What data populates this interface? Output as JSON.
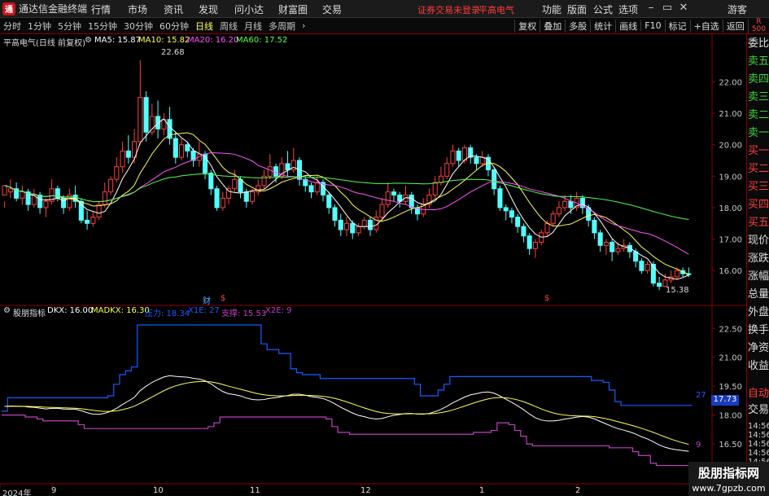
{
  "app": {
    "logo": "通",
    "title": "通达信金融终端",
    "menus": [
      "行情",
      "市场",
      "资讯",
      "发现",
      "问小达",
      "财富圈",
      "交易"
    ],
    "broker_notice": "证券交易未登录",
    "stock_name_top": "平高电气",
    "right_menus": [
      "功能",
      "版面",
      "公式",
      "选项"
    ],
    "guest": "游客",
    "window_controls": {
      "minimize": "–",
      "restore": "▭",
      "close": "✕"
    }
  },
  "toolbar": {
    "periods": [
      "分时",
      "1分钟",
      "5分钟",
      "15分钟",
      "30分钟",
      "60分钟",
      "日线",
      "周线",
      "月线",
      "多周期"
    ],
    "active_period": "日线",
    "buttons": [
      "复权",
      "叠加",
      "多股",
      "统计",
      "画线",
      "F10",
      "标记",
      "+自选",
      "返回"
    ],
    "r_badge": "R",
    "r_num": "500"
  },
  "main_chart": {
    "title": "平高电气(日线 前复权)",
    "ma5": "MA5: 15.87",
    "ma10": "MA10: 15.82",
    "ma20": "MA20: 16.20",
    "ma60": "MA60: 17.52",
    "high_label": "22.68",
    "low_label": "15.38",
    "marker_cai": "财",
    "marker_s1": "$",
    "marker_s2": "$"
  },
  "indicator": {
    "name": "股朋指标",
    "dkx": "DKX: 16.00",
    "madkx": "MADKX: 16.30",
    "pressure": "压力: 18.34",
    "x1e": "X1E: 27",
    "support": "支撑: 15.53",
    "x2e": "X2E: 9",
    "end_label_top": "27",
    "end_label_bottom": "9",
    "price_badge": "17.73"
  },
  "side_panel": {
    "items": [
      "委比",
      "卖五",
      "卖四",
      "卖三",
      "卖二",
      "卖一",
      "买一",
      "买二",
      "买三",
      "买四",
      "买五",
      "现价",
      "涨跌",
      "涨幅",
      "总量",
      "外盘",
      "换手",
      "净资",
      "收益",
      "自动",
      "交易"
    ],
    "times": [
      "14:56",
      "14:56",
      "14:56",
      "14:56",
      "14:56",
      "14:56",
      "14:56",
      "14:56"
    ]
  },
  "xaxis": {
    "labels": [
      "2024年",
      "9",
      "10",
      "11",
      "12",
      "1",
      "2"
    ]
  },
  "watermark": {
    "line1": "股朋指标网",
    "line2": "www.7gpzb.com"
  },
  "colors": {
    "up": "#ff4040",
    "down": "#54ffff",
    "ma5": "#ffffff",
    "ma10": "#ffff54",
    "ma20": "#ff54ff",
    "ma60": "#54ff54",
    "pressure": "#1a5cff",
    "support": "#c040c0",
    "axis": "#8b0000"
  },
  "chart_data": {
    "type": "candlestick",
    "price_axis": {
      "ticks": [
        16,
        17,
        18,
        19,
        20,
        21,
        22
      ],
      "range": [
        15.1,
        23.2
      ]
    },
    "indicator_axis": {
      "ticks": [
        15.0,
        16.5,
        18.0,
        19.5,
        21.0,
        22.5
      ],
      "range": [
        14.6,
        23.4
      ]
    },
    "candles": [
      [
        18.4,
        18.7,
        18.2,
        18.0
      ],
      [
        18.5,
        18.6,
        18.9,
        18.3
      ],
      [
        18.6,
        18.3,
        18.8,
        18.2
      ],
      [
        18.3,
        18.5,
        18.7,
        18.1
      ],
      [
        18.5,
        18.1,
        18.6,
        17.9
      ],
      [
        18.1,
        18.4,
        18.6,
        18.0
      ],
      [
        18.4,
        18.0,
        18.5,
        17.8
      ],
      [
        18.0,
        18.2,
        18.3,
        17.7
      ],
      [
        18.2,
        18.6,
        18.9,
        18.1
      ],
      [
        18.6,
        18.3,
        18.7,
        18.2
      ],
      [
        18.3,
        18.0,
        18.4,
        17.8
      ],
      [
        18.0,
        18.4,
        18.6,
        17.9
      ],
      [
        18.4,
        18.2,
        18.7,
        18.0
      ],
      [
        18.2,
        17.6,
        18.3,
        17.5
      ],
      [
        17.6,
        17.5,
        17.9,
        17.3
      ],
      [
        17.5,
        17.7,
        17.9,
        17.4
      ],
      [
        17.7,
        18.1,
        18.2,
        17.6
      ],
      [
        18.1,
        18.5,
        18.8,
        18.0
      ],
      [
        18.5,
        18.9,
        19.0,
        18.4
      ],
      [
        18.9,
        19.3,
        19.6,
        18.8
      ],
      [
        19.3,
        19.8,
        20.1,
        19.1
      ],
      [
        19.8,
        19.6,
        20.3,
        19.4
      ],
      [
        19.6,
        20.1,
        20.5,
        19.4
      ],
      [
        20.1,
        21.5,
        22.68,
        20.0
      ],
      [
        21.5,
        20.4,
        21.7,
        20.1
      ],
      [
        20.4,
        20.9,
        21.3,
        20.3
      ],
      [
        20.9,
        20.5,
        21.4,
        20.2
      ],
      [
        20.5,
        20.8,
        21.0,
        20.3
      ],
      [
        20.8,
        20.2,
        21.2,
        20.0
      ],
      [
        20.2,
        19.6,
        20.4,
        19.4
      ],
      [
        19.6,
        20.0,
        20.2,
        19.5
      ],
      [
        20.0,
        19.8,
        20.1,
        19.6
      ],
      [
        19.8,
        19.5,
        19.9,
        19.3
      ],
      [
        19.5,
        19.7,
        20.1,
        19.3
      ],
      [
        19.7,
        19.1,
        19.8,
        18.9
      ],
      [
        19.1,
        18.6,
        19.2,
        18.4
      ],
      [
        18.6,
        18.0,
        18.7,
        17.9
      ],
      [
        18.0,
        18.3,
        18.5,
        17.9
      ],
      [
        18.3,
        18.6,
        18.7,
        18.1
      ],
      [
        18.6,
        18.9,
        19.2,
        18.5
      ],
      [
        18.9,
        18.5,
        19.0,
        18.3
      ],
      [
        18.5,
        18.2,
        18.6,
        18.0
      ],
      [
        18.2,
        18.5,
        18.6,
        18.1
      ],
      [
        18.5,
        18.7,
        18.9,
        18.4
      ],
      [
        18.7,
        19.0,
        19.2,
        18.6
      ],
      [
        19.0,
        19.3,
        19.7,
        18.9
      ],
      [
        19.3,
        19.0,
        19.4,
        18.8
      ],
      [
        19.0,
        19.4,
        19.6,
        18.9
      ],
      [
        19.4,
        19.2,
        19.8,
        19.0
      ],
      [
        19.2,
        19.5,
        19.9,
        19.1
      ],
      [
        19.5,
        18.9,
        19.6,
        18.7
      ],
      [
        18.9,
        18.7,
        19.0,
        18.5
      ],
      [
        18.7,
        18.5,
        18.8,
        18.3
      ],
      [
        18.5,
        18.8,
        19.0,
        18.4
      ],
      [
        18.8,
        18.4,
        18.9,
        18.2
      ],
      [
        18.4,
        18.0,
        18.5,
        17.8
      ],
      [
        18.0,
        17.6,
        18.1,
        17.4
      ],
      [
        17.6,
        17.3,
        17.8,
        17.1
      ],
      [
        17.3,
        17.5,
        17.7,
        17.1
      ],
      [
        17.5,
        17.2,
        17.6,
        17.0
      ],
      [
        17.2,
        17.4,
        17.5,
        17.1
      ],
      [
        17.4,
        17.6,
        17.7,
        17.3
      ],
      [
        17.6,
        17.3,
        17.7,
        17.1
      ],
      [
        17.3,
        17.7,
        17.9,
        17.2
      ],
      [
        17.7,
        18.1,
        18.3,
        17.6
      ],
      [
        18.1,
        18.5,
        18.8,
        18.0
      ],
      [
        18.5,
        18.4,
        18.6,
        18.2
      ],
      [
        18.4,
        18.2,
        18.5,
        18.0
      ],
      [
        18.2,
        18.4,
        18.7,
        18.1
      ],
      [
        18.4,
        18.0,
        18.5,
        17.8
      ],
      [
        18.0,
        17.8,
        18.1,
        17.6
      ],
      [
        17.8,
        18.1,
        18.3,
        17.7
      ],
      [
        18.1,
        18.4,
        18.6,
        18.0
      ],
      [
        18.4,
        18.8,
        19.0,
        18.3
      ],
      [
        18.8,
        19.0,
        19.3,
        18.7
      ],
      [
        19.0,
        19.4,
        19.6,
        18.9
      ],
      [
        19.4,
        19.8,
        20.0,
        19.3
      ],
      [
        19.8,
        19.5,
        19.9,
        19.3
      ],
      [
        19.5,
        19.9,
        20.0,
        19.4
      ],
      [
        19.9,
        19.6,
        20.0,
        19.4
      ],
      [
        19.6,
        19.4,
        19.7,
        19.2
      ],
      [
        19.4,
        19.6,
        19.8,
        19.3
      ],
      [
        19.6,
        19.2,
        19.7,
        19.0
      ],
      [
        19.2,
        18.6,
        19.3,
        18.4
      ],
      [
        18.6,
        18.0,
        18.7,
        17.9
      ],
      [
        18.0,
        17.9,
        18.1,
        17.6
      ],
      [
        17.9,
        17.7,
        18.0,
        17.5
      ],
      [
        17.7,
        17.4,
        17.8,
        17.2
      ],
      [
        17.4,
        17.1,
        17.5,
        16.9
      ],
      [
        17.1,
        16.7,
        17.2,
        16.5
      ],
      [
        16.7,
        16.9,
        17.0,
        16.4
      ],
      [
        16.9,
        17.2,
        17.3,
        16.8
      ],
      [
        17.2,
        17.5,
        17.6,
        17.1
      ],
      [
        17.5,
        17.8,
        17.9,
        17.4
      ],
      [
        17.8,
        18.0,
        18.2,
        17.7
      ],
      [
        18.0,
        18.2,
        18.4,
        17.9
      ],
      [
        18.2,
        18.0,
        18.4,
        17.8
      ],
      [
        18.0,
        18.3,
        18.5,
        17.9
      ],
      [
        18.3,
        18.0,
        18.4,
        17.8
      ],
      [
        18.0,
        17.6,
        18.1,
        17.4
      ],
      [
        17.6,
        17.2,
        17.7,
        17.0
      ],
      [
        17.2,
        16.8,
        17.3,
        16.6
      ],
      [
        16.8,
        16.9,
        17.0,
        16.5
      ],
      [
        16.9,
        16.6,
        17.0,
        16.3
      ],
      [
        16.6,
        16.7,
        16.9,
        16.5
      ],
      [
        16.7,
        16.8,
        17.0,
        16.6
      ],
      [
        16.8,
        16.6,
        16.9,
        16.4
      ],
      [
        16.6,
        16.3,
        16.7,
        16.1
      ],
      [
        16.3,
        16.0,
        16.4,
        15.9
      ],
      [
        16.0,
        16.2,
        16.3,
        15.9
      ],
      [
        16.2,
        15.6,
        16.3,
        15.5
      ],
      [
        15.6,
        15.5,
        15.8,
        15.38
      ],
      [
        15.5,
        15.7,
        15.9,
        15.5
      ],
      [
        15.7,
        15.8,
        16.0,
        15.6
      ],
      [
        15.8,
        16.0,
        16.1,
        15.7
      ],
      [
        16.0,
        15.9,
        16.1,
        15.8
      ],
      [
        15.9,
        15.87,
        16.1,
        15.8
      ]
    ]
  }
}
